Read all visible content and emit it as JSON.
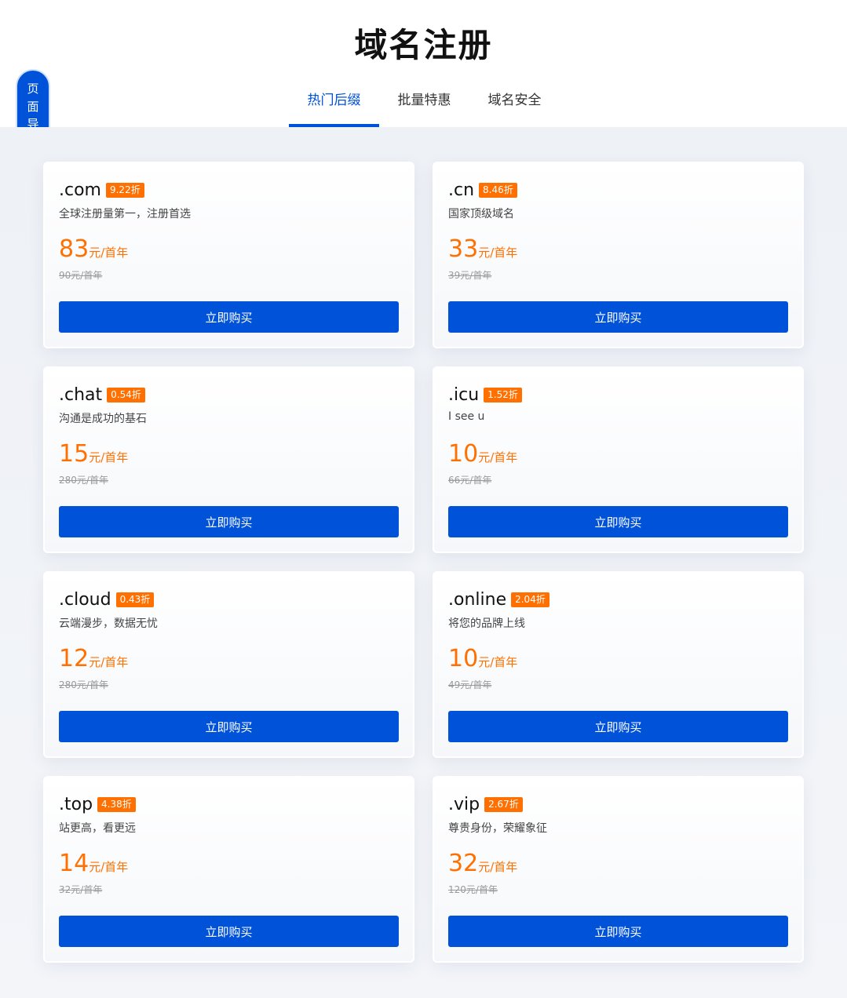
{
  "header": {
    "title": "域名注册",
    "tabs": [
      "热门后缀",
      "批量特惠",
      "域名安全"
    ]
  },
  "side_nav": {
    "label": "页面导航"
  },
  "colors": {
    "accent": "#0052d9",
    "price": "#ff7000",
    "badge": "#ff7000"
  },
  "cards": [
    {
      "suffix": ".com",
      "discount": "9.22折",
      "desc": "全球注册量第一，注册首选",
      "price": "83",
      "unit": "元/首年",
      "original": "90元/首年",
      "button": "立即购买"
    },
    {
      "suffix": ".cn",
      "discount": "8.46折",
      "desc": "国家顶级域名",
      "price": "33",
      "unit": "元/首年",
      "original": "39元/首年",
      "button": "立即购买"
    },
    {
      "suffix": ".chat",
      "discount": "0.54折",
      "desc": "沟通是成功的基石",
      "price": "15",
      "unit": "元/首年",
      "original": "280元/首年",
      "button": "立即购买"
    },
    {
      "suffix": ".icu",
      "discount": "1.52折",
      "desc": "I see u",
      "price": "10",
      "unit": "元/首年",
      "original": "66元/首年",
      "button": "立即购买"
    },
    {
      "suffix": ".cloud",
      "discount": "0.43折",
      "desc": "云端漫步，数据无忧",
      "price": "12",
      "unit": "元/首年",
      "original": "280元/首年",
      "button": "立即购买"
    },
    {
      "suffix": ".online",
      "discount": "2.04折",
      "desc": "将您的品牌上线",
      "price": "10",
      "unit": "元/首年",
      "original": "49元/首年",
      "button": "立即购买"
    },
    {
      "suffix": ".top",
      "discount": "4.38折",
      "desc": "站更高，看更远",
      "price": "14",
      "unit": "元/首年",
      "original": "32元/首年",
      "button": "立即购买"
    },
    {
      "suffix": ".vip",
      "discount": "2.67折",
      "desc": "尊贵身份，荣耀象征",
      "price": "32",
      "unit": "元/首年",
      "original": "120元/首年",
      "button": "立即购买"
    }
  ]
}
